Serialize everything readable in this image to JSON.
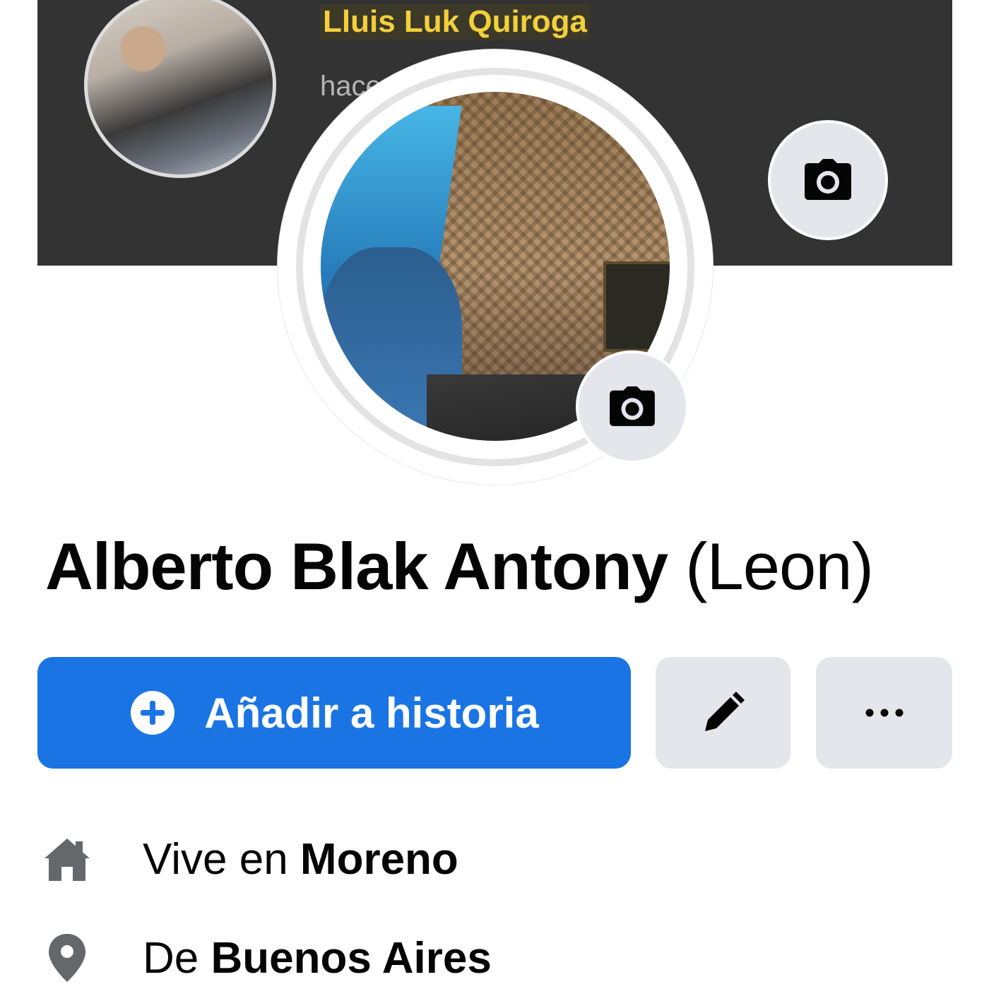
{
  "cover": {
    "featured_name": "Lluis Luk Quiroga",
    "featured_subtext": "hace ... desde Android",
    "camera_icon": "camera-icon"
  },
  "profile": {
    "camera_icon": "camera-icon",
    "first_name": "Alberto Blak Antony",
    "alternate_name": "(Leon)"
  },
  "actions": {
    "add_story_label": "Añadir a historia",
    "add_story_icon": "plus-circle-icon",
    "edit_icon": "pencil-icon",
    "more_icon": "more-dots-icon"
  },
  "info": {
    "lives_prefix": "Vive en",
    "lives_value": "Moreno",
    "lives_icon": "home-icon",
    "from_prefix": "De",
    "from_value": "Buenos Aires",
    "from_icon": "location-pin-icon"
  },
  "colors": {
    "primary": "#1b74e4",
    "secondary_button": "#e4e6eb",
    "cover_bg": "#333333",
    "featured_name": "#f2d03b",
    "icon_gray": "#65676b"
  }
}
